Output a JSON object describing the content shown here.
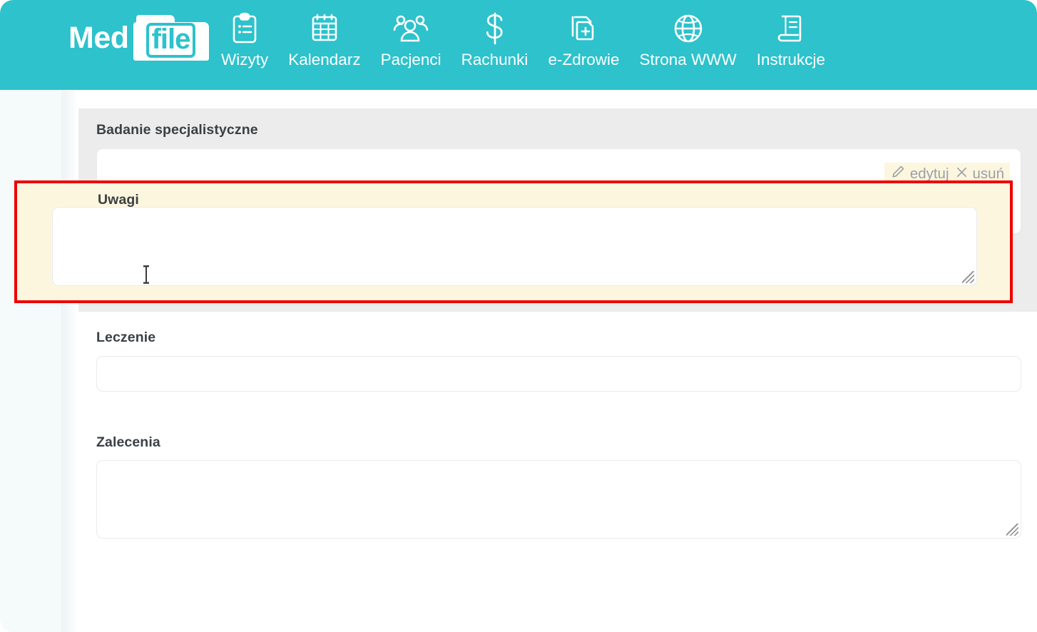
{
  "brand": {
    "word_med": "Med",
    "word_file": "file",
    "name": "MedFile"
  },
  "nav": {
    "items": [
      {
        "label": "Wizyty",
        "icon": "clipboard-icon"
      },
      {
        "label": "Kalendarz",
        "icon": "calendar-icon"
      },
      {
        "label": "Pacjenci",
        "icon": "people-icon"
      },
      {
        "label": "Rachunki",
        "icon": "dollar-icon"
      },
      {
        "label": "e-Zdrowie",
        "icon": "medical-documents-icon"
      },
      {
        "label": "Strona WWW",
        "icon": "globe-icon"
      },
      {
        "label": "Instrukcje",
        "icon": "book-icon"
      }
    ]
  },
  "form": {
    "badanie": {
      "label": "Badanie specjalistyczne",
      "value": "",
      "actions": {
        "edit_label": "edytuj",
        "edit_icon": "pencil-icon",
        "delete_label": "usuń",
        "delete_icon": "close-x-icon"
      }
    },
    "uwagi": {
      "label": "Uwagi",
      "value": "",
      "placeholder": ""
    },
    "leczenie": {
      "label": "Leczenie",
      "value": "",
      "placeholder": ""
    },
    "zalecenia": {
      "label": "Zalecenia",
      "value": "",
      "placeholder": ""
    }
  },
  "colors": {
    "brand_teal": "#2dc2cc",
    "highlight_border": "#ef0000",
    "highlight_fill": "#fdf6df",
    "panel_gray": "#ececec",
    "label_text": "#3c4044",
    "muted_link": "#9aa0a6"
  }
}
